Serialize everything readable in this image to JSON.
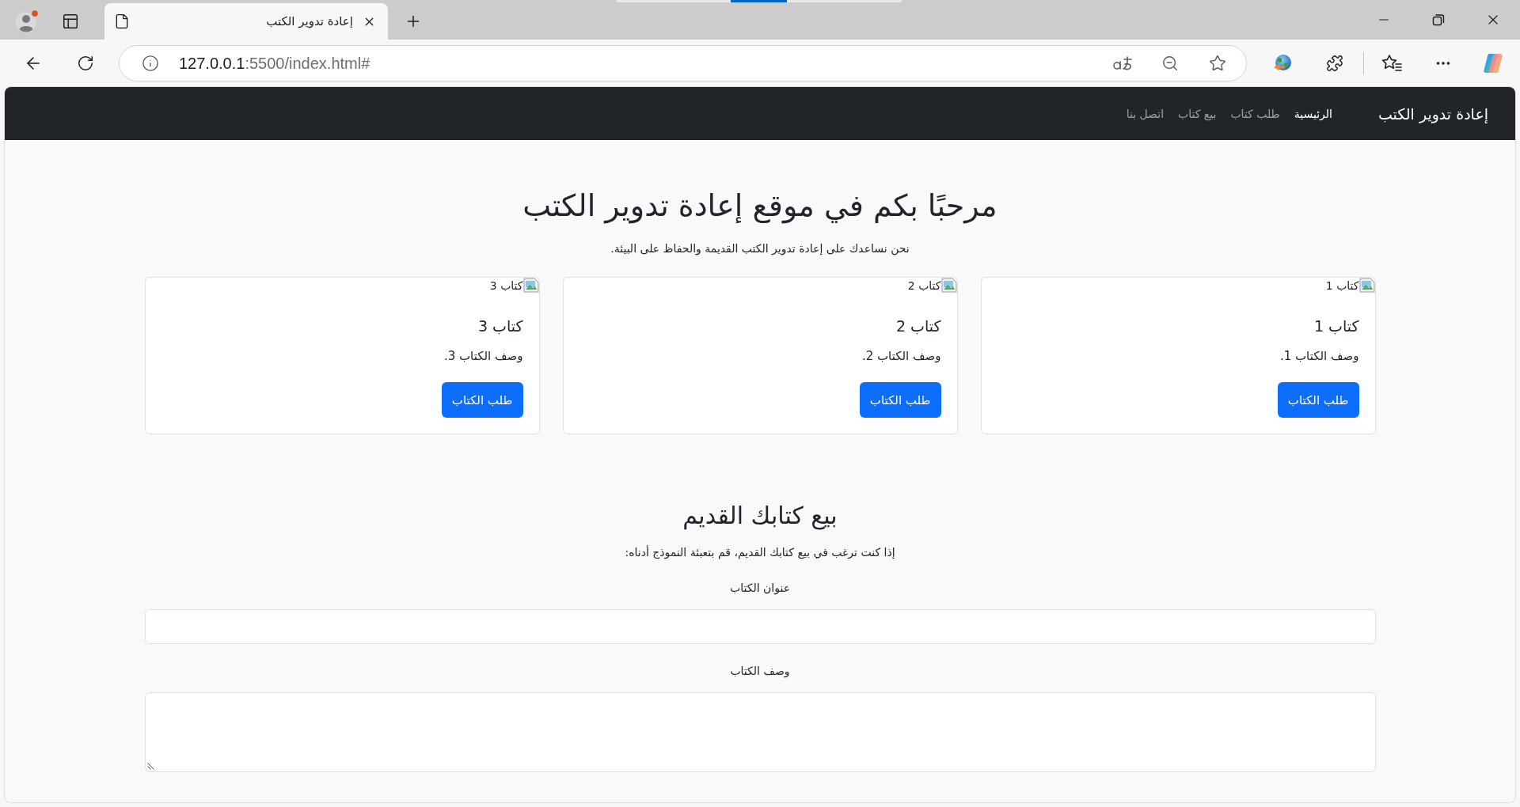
{
  "browser": {
    "tab": {
      "title": "إعادة تدوير الكتب"
    },
    "address_bar": {
      "host": "127.0.0.1",
      "path": ":5500/index.html#"
    }
  },
  "navbar": {
    "brand": "إعادة تدوير الكتب",
    "links": [
      {
        "label": "الرئيسية",
        "selected": true
      },
      {
        "label": "طلب كتاب",
        "selected": false
      },
      {
        "label": "بيع كتاب",
        "selected": false
      },
      {
        "label": "اتصل بنا",
        "selected": false
      }
    ]
  },
  "hero": {
    "title": "مرحبًا بكم في موقع إعادة تدوير الكتب",
    "subtitle": "نحن نساعدك على إعادة تدوير الكتب القديمة والحفاظ على البيئة."
  },
  "cards": [
    {
      "image_alt": "كتاب 1",
      "title": "كتاب 1",
      "text": "وصف الكتاب 1.",
      "button": "طلب الكتاب"
    },
    {
      "image_alt": "كتاب 2",
      "title": "كتاب 2",
      "text": "وصف الكتاب 2.",
      "button": "طلب الكتاب"
    },
    {
      "image_alt": "كتاب 3",
      "title": "كتاب 3",
      "text": "وصف الكتاب 3.",
      "button": "طلب الكتاب"
    }
  ],
  "sell_section": {
    "title": "بيع كتابك القديم",
    "intro": "إذا كنت ترغب في بيع كتابك القديم، قم بتعبئة النموذج أدناه:",
    "fields": [
      {
        "kind": "input",
        "label": "عنوان الكتاب"
      },
      {
        "kind": "textarea",
        "label": "وصف الكتاب"
      }
    ]
  }
}
